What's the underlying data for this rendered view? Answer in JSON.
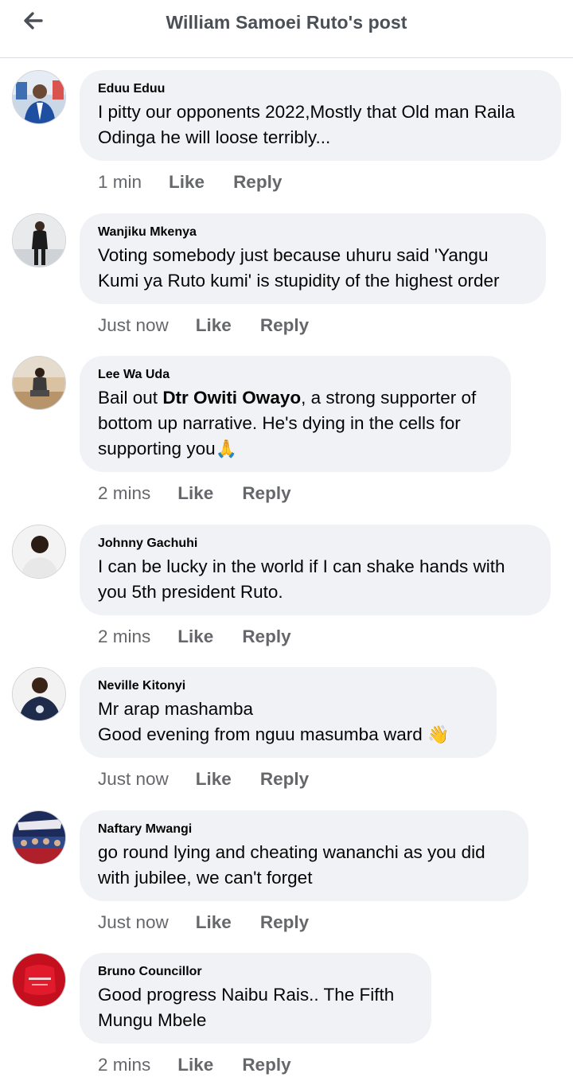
{
  "header": {
    "title": "William Samoei Ruto's post",
    "back_icon": "arrow-left-icon"
  },
  "comments": [
    {
      "author": "Eduu Eduu",
      "text": "I pitty our opponents 2022,Mostly that Old man Raila Odinga he will loose terribly...",
      "time": "1 min",
      "like": "Like",
      "reply": "Reply"
    },
    {
      "author": "Wanjiku Mkenya",
      "text": "Voting somebody just because uhuru said 'Yangu Kumi ya Ruto kumi' is stupidity of the highest order",
      "time": "Just now",
      "like": "Like",
      "reply": "Reply"
    },
    {
      "author": "Lee Wa Uda",
      "text_before": "Bail out ",
      "text_bold": "Dtr Owiti Owayo",
      "text_after": ", a strong supporter of bottom up narrative. He's dying in the cells for supporting you",
      "emoji": "🙏",
      "time": "2 mins",
      "like": "Like",
      "reply": "Reply"
    },
    {
      "author": "Johnny Gachuhi",
      "text": "I can be lucky in the world if I can shake hands with you 5th president Ruto.",
      "time": "2 mins",
      "like": "Like",
      "reply": "Reply"
    },
    {
      "author": "Neville Kitonyi",
      "text_line1": "Mr arap mashamba",
      "text_line2": "Good evening from nguu masumba ward",
      "emoji": "👋",
      "time": "Just now",
      "like": "Like",
      "reply": "Reply"
    },
    {
      "author": "Naftary Mwangi",
      "text": "go round lying and cheating wananchi as you did with jubilee, we can't forget",
      "time": "Just now",
      "like": "Like",
      "reply": "Reply"
    },
    {
      "author": "Bruno Councillor",
      "text": "Good progress Naibu Rais.. The Fifth Mungu Mbele",
      "time": "2 mins",
      "like": "Like",
      "reply": "Reply"
    }
  ],
  "colors": {
    "bubble": "#f0f2f5",
    "meta_text": "#65676b",
    "title_text": "#4b4f56"
  }
}
